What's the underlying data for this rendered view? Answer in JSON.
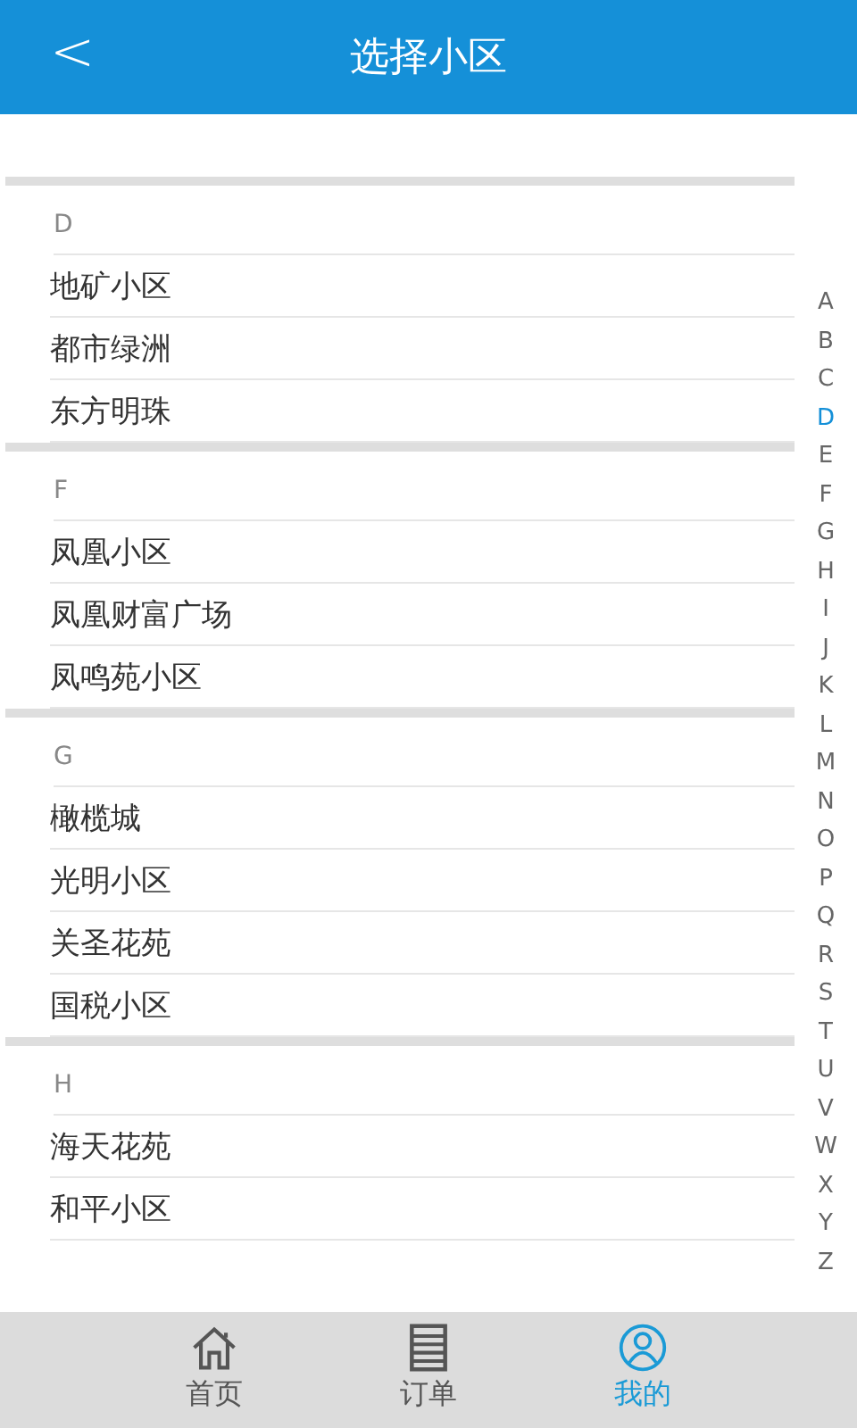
{
  "header": {
    "back_icon": "<",
    "title": "选择小区"
  },
  "sections": [
    {
      "letter": "D",
      "items": [
        "地矿小区",
        "都市绿洲",
        "东方明珠"
      ]
    },
    {
      "letter": "F",
      "items": [
        "凤凰小区",
        "凤凰财富广场",
        "凤鸣苑小区"
      ]
    },
    {
      "letter": "G",
      "items": [
        "橄榄城",
        "光明小区",
        "关圣花苑",
        "国税小区"
      ]
    },
    {
      "letter": "H",
      "items": [
        "海天花苑",
        "和平小区"
      ]
    }
  ],
  "index": [
    {
      "label": "A",
      "selected": false
    },
    {
      "label": "B",
      "selected": false
    },
    {
      "label": "C",
      "selected": false
    },
    {
      "label": "D",
      "selected": true
    },
    {
      "label": "E",
      "selected": false
    },
    {
      "label": "F",
      "selected": false
    },
    {
      "label": "G",
      "selected": false
    },
    {
      "label": "H",
      "selected": false
    },
    {
      "label": "I",
      "selected": false
    },
    {
      "label": "J",
      "selected": false
    },
    {
      "label": "K",
      "selected": false
    },
    {
      "label": "L",
      "selected": false
    },
    {
      "label": "M",
      "selected": false
    },
    {
      "label": "N",
      "selected": false
    },
    {
      "label": "O",
      "selected": false
    },
    {
      "label": "P",
      "selected": false
    },
    {
      "label": "Q",
      "selected": false
    },
    {
      "label": "R",
      "selected": false
    },
    {
      "label": "S",
      "selected": false
    },
    {
      "label": "T",
      "selected": false
    },
    {
      "label": "U",
      "selected": false
    },
    {
      "label": "V",
      "selected": false
    },
    {
      "label": "W",
      "selected": false
    },
    {
      "label": "X",
      "selected": false
    },
    {
      "label": "Y",
      "selected": false
    },
    {
      "label": "Z",
      "selected": false
    }
  ],
  "tabs": [
    {
      "kind": "home",
      "label": "首页",
      "selected": false
    },
    {
      "kind": "orders",
      "label": "订单",
      "selected": false
    },
    {
      "kind": "profile",
      "label": "我的",
      "selected": true
    }
  ]
}
